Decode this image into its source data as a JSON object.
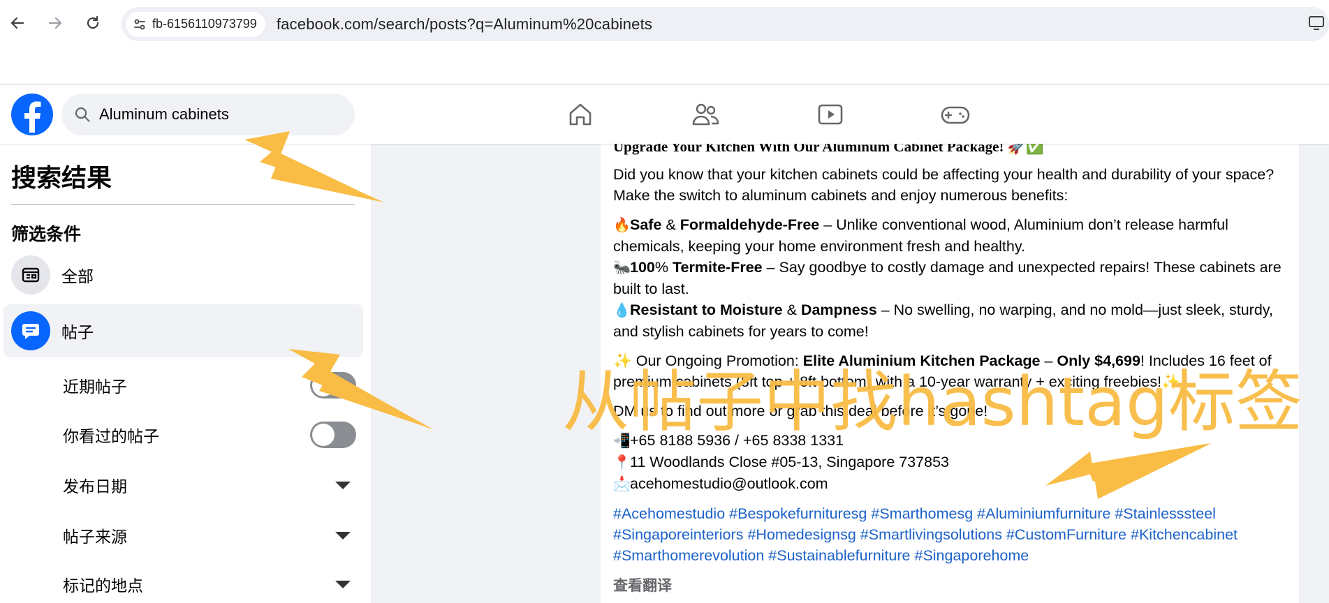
{
  "browser": {
    "site_chip": "fb-6156110973799",
    "url": "facebook.com/search/posts?q=Aluminum%20cabinets"
  },
  "fb": {
    "search_value": "Aluminum cabinets",
    "nav": [
      "home-icon",
      "friends-icon",
      "video-icon",
      "gaming-icon"
    ],
    "brand_color": "#0866ff"
  },
  "sidebar": {
    "title": "搜索结果",
    "filters_heading": "筛选条件",
    "items": [
      {
        "label": "全部"
      },
      {
        "label": "帖子"
      }
    ],
    "sub_filters": [
      {
        "label": "近期帖子",
        "control": "toggle",
        "on": false
      },
      {
        "label": "你看过的帖子",
        "control": "toggle",
        "on": false
      },
      {
        "label": "发布日期",
        "control": "dropdown"
      },
      {
        "label": "帖子来源",
        "control": "dropdown"
      },
      {
        "label": "标记的地点",
        "control": "dropdown"
      }
    ]
  },
  "post": {
    "headline": "Upgrade Your Kitchen With Our Aluminum Cabinet Package!",
    "headline_emoji": "🚀✅",
    "intro": "Did you know that your kitchen cabinets could be affecting your health and durability of your space? Make the switch to aluminum cabinets and enjoy numerous benefits:",
    "benefits": [
      {
        "emoji": "🔥",
        "bold_a": "Safe",
        "mid": " & ",
        "bold_b": "Formaldehyde-Free",
        "rest": " – Unlike conventional wood, Aluminium don’t release harmful chemicals, keeping your home environment fresh and healthy."
      },
      {
        "emoji": "🐜",
        "bold_a": "100",
        "mid": "% ",
        "bold_b": "Termite-Free",
        "rest": " – Say goodbye to costly damage and unexpected repairs! These cabinets are built to last."
      },
      {
        "emoji": "💧",
        "bold_a": "Resistant to Moisture",
        "mid": " & ",
        "bold_b": "Dampness",
        "rest": " – No swelling, no warping, and no mold—just sleek, sturdy, and stylish cabinets for years to come!"
      }
    ],
    "promo": {
      "emoji": "✨",
      "prefix": " Our Ongoing Promotion: ",
      "bold_a": "Elite Aluminium Kitchen Package",
      "mid": " – ",
      "bold_b": "Only $4,699",
      "rest": "! Includes 16 feet of premium cabinets (8ft top + 8ft bottom) with a 10-year warranty + exciting freebies!",
      "emoji_end": "✨"
    },
    "cta": "DM us to find out more or grab this deal before it’s gone!",
    "contacts": [
      {
        "emoji": "📲",
        "text": "+65 8188 5936 / +65 8338 1331"
      },
      {
        "emoji": "📍",
        "text": "11 Woodlands Close #05-13, Singapore 737853"
      },
      {
        "emoji": "📩",
        "text": "acehomestudio@outlook.com"
      }
    ],
    "hashtags": [
      "#Acehomestudio",
      "#Bespokefurnituresg",
      "#Smarthomesg",
      "#Aluminiumfurniture",
      "#Stainlesssteel",
      "#Singaporeinteriors",
      "#Homedesignsg",
      "#Smartlivingsolutions",
      "#CustomFurniture",
      "#Kitchencabinet",
      "#Smarthomerevolution",
      "#Sustainablefurniture",
      "#Singaporehome"
    ],
    "see_translation": "查看翻译"
  },
  "annotation": {
    "overlay_text": "从帖子中找hashtag标签",
    "color": "#f9bc45"
  }
}
